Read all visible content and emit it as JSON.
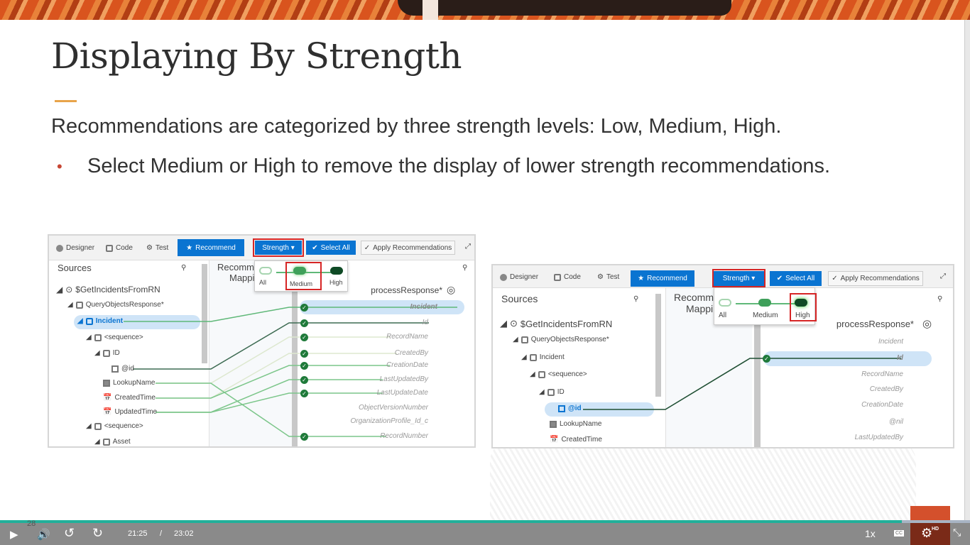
{
  "slide": {
    "title": "Displaying By Strength",
    "lead": "Recommendations are categorized by three strength levels: Low, Medium, High.",
    "bullet_marker": "•",
    "bullet": "Select Medium or High to remove the display of lower strength recommendations.",
    "page_number": "28"
  },
  "toolbar": {
    "designer": "Designer",
    "code": "Code",
    "test": "Test",
    "recommend": "Recommend",
    "strength": "Strength ▾",
    "select_all": "Select All",
    "apply": "Apply Recommendations"
  },
  "strength_options": [
    "All",
    "Medium",
    "High"
  ],
  "panel1": {
    "sources": "Sources",
    "middle1": "Recomm",
    "middle2": "Mappi",
    "selected_strength": "Medium",
    "source_tree": [
      "$GetIncidentsFromRN",
      "QueryObjectsResponse*",
      "Incident",
      "<sequence>",
      "ID",
      "@id",
      "LookupName",
      "CreatedTime",
      "UpdatedTime",
      "<sequence>",
      "Asset"
    ],
    "target_root": "processResponse*",
    "targets": [
      "Incident",
      "Id",
      "RecordName",
      "CreatedBy",
      "CreationDate",
      "LastUpdatedBy",
      "LastUpdateDate",
      "ObjectVersionNumber",
      "OrganizationProfile_Id_c",
      "RecordNumber"
    ]
  },
  "panel2": {
    "sources": "Sources",
    "middle1": "Recomm",
    "middle2": "Mappi",
    "selected_strength": "High",
    "source_tree": [
      "$GetIncidentsFromRN",
      "QueryObjectsResponse*",
      "Incident",
      "<sequence>",
      "ID",
      "@id",
      "LookupName",
      "CreatedTime"
    ],
    "target_root": "processResponse*",
    "targets": [
      "Incident",
      "Id",
      "RecordName",
      "CreatedBy",
      "CreationDate",
      "@nil",
      "LastUpdatedBy"
    ]
  },
  "player": {
    "current": "21:25",
    "separator": "/",
    "duration": "23:02",
    "speed": "1x",
    "cc": "CC",
    "hd": "HD",
    "progress": 0.93
  },
  "colors": {
    "accent": "#e8a44a",
    "primary_button": "#0a74d1",
    "highlight": "#d62525",
    "progress": "#22b09a"
  }
}
